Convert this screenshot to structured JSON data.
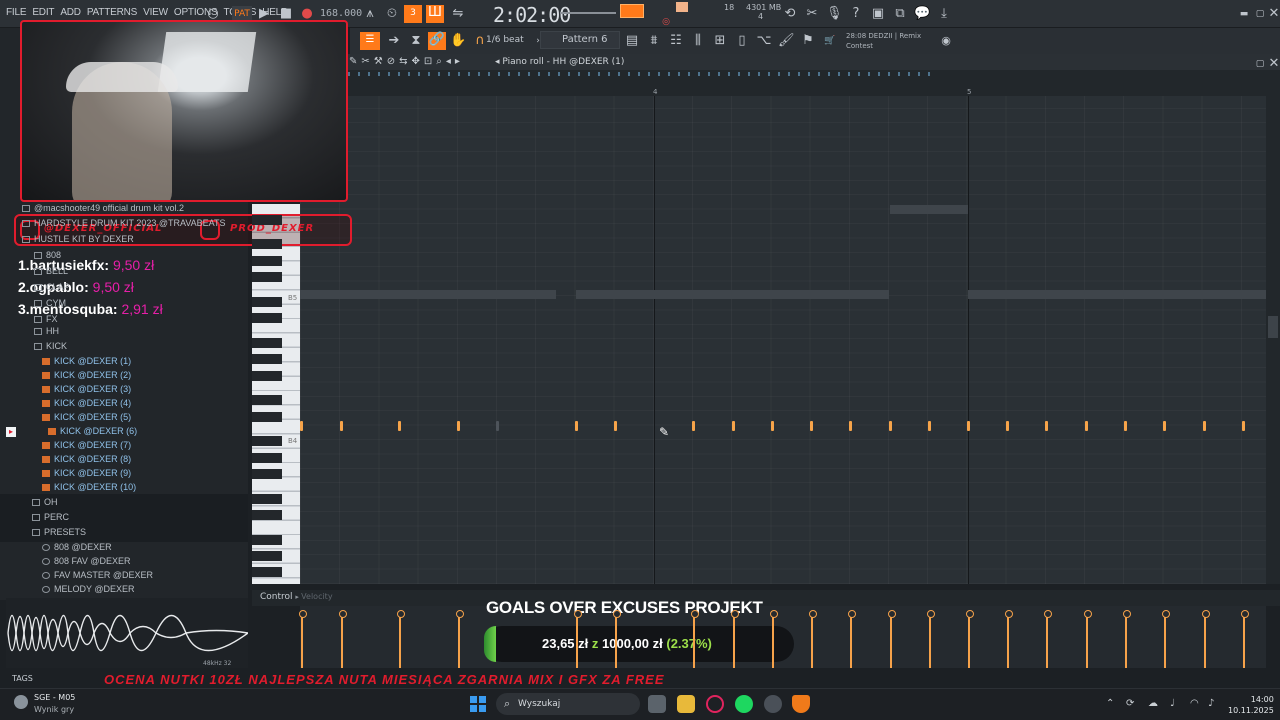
{
  "menu": [
    "FILE",
    "EDIT",
    "ADD",
    "PATTERNS",
    "VIEW",
    "OPTIONS",
    "TOOLS",
    "HELP"
  ],
  "transport": {
    "tempo": "168.000",
    "time": "2:02:00",
    "cpu_top": "4301 MB",
    "cpu_mid": "18",
    "cpu_bottom": "4"
  },
  "toolbar2": {
    "snap": "1/6 beat",
    "pattern": "Pattern 6",
    "news_time": "28:08",
    "news_title": "DEDZII | Remix",
    "news_sub": "Contest"
  },
  "piano_roll": {
    "title": "Piano roll - HH @DEXER (1)",
    "ruler_marks": [
      "4",
      "5"
    ],
    "key_labels": [
      "B5",
      "B4"
    ],
    "control_label": "Control",
    "control_sub": "Velocity"
  },
  "browser": {
    "items": [
      {
        "label": "@macshooter49 official drum kit vol.2",
        "type": "folder"
      },
      {
        "label": "HARDSTYLE DRUM KIT 2023 @TRAVABEATS",
        "type": "folder"
      },
      {
        "label": "HUSTLE KIT BY DEXER",
        "type": "folder"
      },
      {
        "label": "808",
        "type": "folder"
      },
      {
        "label": "BELL",
        "type": "folder"
      },
      {
        "label": "CLAP",
        "type": "folder"
      },
      {
        "label": "CYM",
        "type": "folder"
      },
      {
        "label": "FX",
        "type": "folder"
      },
      {
        "label": "HH",
        "type": "folder"
      },
      {
        "label": "KICK",
        "type": "folder"
      },
      {
        "label": "KICK @DEXER (1)",
        "type": "kick"
      },
      {
        "label": "KICK @DEXER (2)",
        "type": "kick"
      },
      {
        "label": "KICK @DEXER (3)",
        "type": "kick"
      },
      {
        "label": "KICK @DEXER (4)",
        "type": "kick"
      },
      {
        "label": "KICK @DEXER (5)",
        "type": "kick"
      },
      {
        "label": "KICK @DEXER (6)",
        "type": "kick"
      },
      {
        "label": "KICK @DEXER (7)",
        "type": "kick"
      },
      {
        "label": "KICK @DEXER (8)",
        "type": "kick"
      },
      {
        "label": "KICK @DEXER (9)",
        "type": "kick"
      },
      {
        "label": "KICK @DEXER (10)",
        "type": "kick"
      },
      {
        "label": "OH",
        "type": "folder"
      },
      {
        "label": "PERC",
        "type": "folder"
      },
      {
        "label": "PRESETS",
        "type": "folder"
      },
      {
        "label": "808 @DEXER",
        "type": "preset"
      },
      {
        "label": "808 FAV @DEXER",
        "type": "preset"
      },
      {
        "label": "FAV MASTER @DEXER",
        "type": "preset"
      },
      {
        "label": "MELODY @DEXER",
        "type": "preset"
      }
    ],
    "wave_meta": "48kHz 32",
    "tags_label": "TAGS"
  },
  "overlay": {
    "instagram_1": "@DEXER_OFFICIAL",
    "instagram_2": "PROD_DEXER",
    "donors": [
      {
        "rank_name": "1.bartusiekfx:",
        "amount": "9,50 zł"
      },
      {
        "rank_name": "2.ogpablo:",
        "amount": "9,50 zł"
      },
      {
        "rank_name": "3.mentosquba:",
        "amount": "2,91 zł"
      }
    ],
    "goal_title": "GOALS OVER EXCUSES PROJEKT",
    "goal_current": "23,65 zł",
    "goal_z": "z",
    "goal_target": "1000,00 zł",
    "goal_pct": "(2.37%)",
    "goal_progress": 0.0237,
    "ticker": "OCENA NUTKI 10ZŁ  NAJLEPSZA NUTA MIESIĄCA ZGARNIA MIX I GFX ZA FREE"
  },
  "taskbar": {
    "weather_title": "SGE - M05",
    "weather_sub": "Wynik gry",
    "search_placeholder": "Wyszukaj",
    "time": "14:00",
    "date": "10.11.2025"
  },
  "colors": {
    "accent": "#f7a44a",
    "overlay_red": "#e11c2d",
    "donor_pink": "#e61fa8",
    "goal_green": "#9de04a"
  }
}
